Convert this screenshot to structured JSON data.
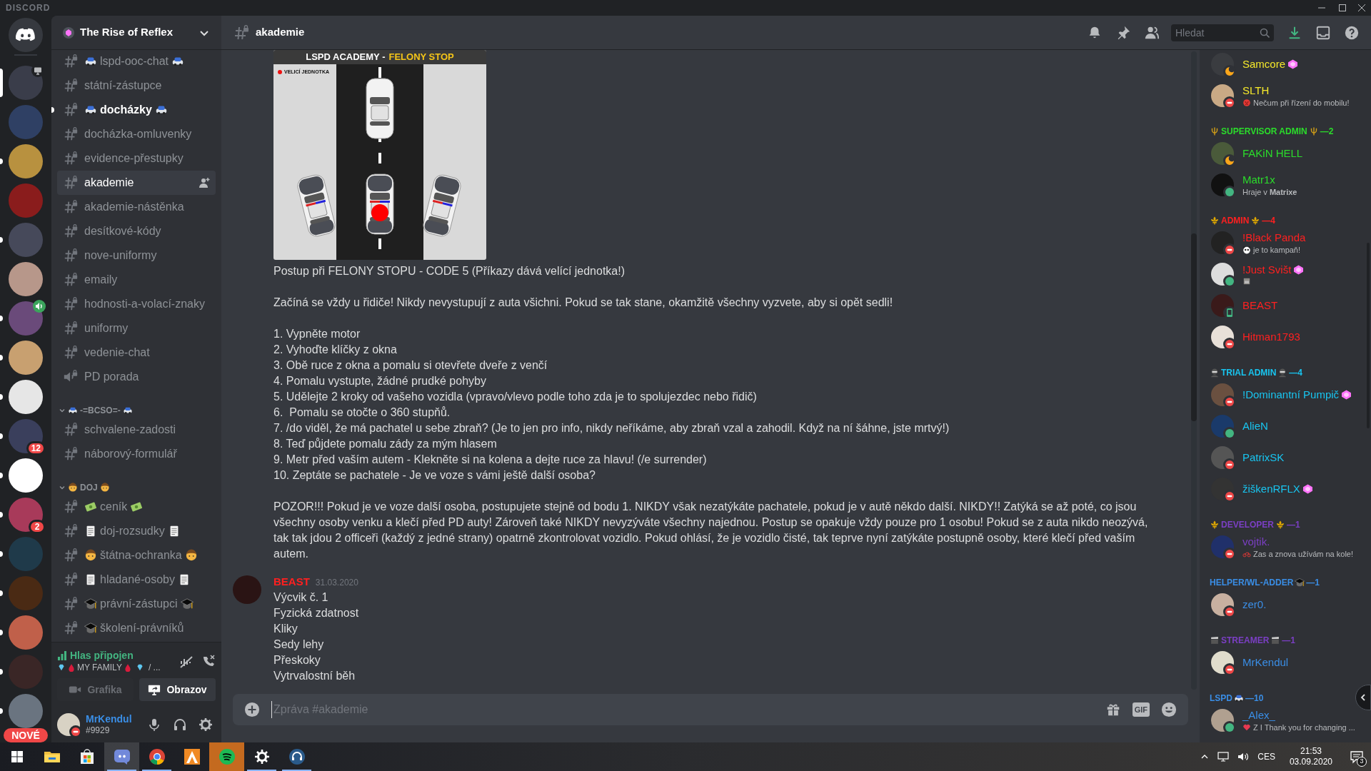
{
  "window": {
    "brand": "DISCORD"
  },
  "servers": [
    {
      "selected": true,
      "unread": false,
      "badge": {
        "kind": "screen"
      }
    },
    {
      "selected": false,
      "unread": false
    },
    {
      "selected": false,
      "unread": true
    },
    {
      "selected": false,
      "unread": false
    },
    {
      "selected": false,
      "unread": true
    },
    {
      "selected": false,
      "unread": false
    },
    {
      "selected": false,
      "unread": true,
      "badge": {
        "kind": "voice"
      }
    },
    {
      "selected": false,
      "unread": true
    },
    {
      "selected": false,
      "unread": true
    },
    {
      "selected": false,
      "unread": true,
      "mention": "12"
    },
    {
      "selected": false,
      "unread": true
    },
    {
      "selected": false,
      "unread": true,
      "mention": "2"
    },
    {
      "selected": false,
      "unread": true
    },
    {
      "selected": false,
      "unread": true
    },
    {
      "selected": false,
      "unread": true
    },
    {
      "selected": false,
      "unread": true
    },
    {
      "selected": false,
      "unread": true,
      "label": "NOVÉ"
    }
  ],
  "server": {
    "name": "The Rise of Reflex"
  },
  "channel_groups": [
    {
      "channels": [
        {
          "name": "lspd-ooc-chat",
          "kind": "text",
          "emoji": {
            "kind": "car",
            "before": true,
            "after": true
          },
          "unread": false,
          "selected": false
        },
        {
          "name": "státní-zástupce",
          "kind": "text",
          "unread": false,
          "selected": false
        },
        {
          "name": "docházky",
          "kind": "text",
          "emoji": {
            "kind": "car",
            "before": true,
            "after": true
          },
          "unread": true,
          "selected": false
        },
        {
          "name": "docházka-omluvenky",
          "kind": "text",
          "unread": false,
          "selected": false
        },
        {
          "name": "evidence-přestupky",
          "kind": "text",
          "unread": false,
          "selected": false
        },
        {
          "name": "akademie",
          "kind": "text",
          "unread": false,
          "selected": true
        },
        {
          "name": "akademie-nástěnka",
          "kind": "text",
          "unread": false,
          "selected": false
        },
        {
          "name": "desítkové-kódy",
          "kind": "text",
          "unread": false,
          "selected": false
        },
        {
          "name": "nove-uniformy",
          "kind": "text",
          "unread": false,
          "selected": false
        },
        {
          "name": "emaily",
          "kind": "text",
          "unread": false,
          "selected": false
        },
        {
          "name": "hodnosti-a-volací-znaky",
          "kind": "text",
          "unread": false,
          "selected": false
        },
        {
          "name": "uniformy",
          "kind": "text",
          "unread": false,
          "selected": false
        },
        {
          "name": "vedenie-chat",
          "kind": "text",
          "unread": false,
          "selected": false
        },
        {
          "name": "PD porada",
          "kind": "voice",
          "unread": false,
          "selected": false
        }
      ]
    },
    {
      "name": "-=BCSO=-",
      "emoji": {
        "kind": "car"
      },
      "expanded": true,
      "channels": [
        {
          "name": "schvalene-zadosti",
          "kind": "text",
          "unread": false,
          "selected": false
        },
        {
          "name": "náborový-formulář",
          "kind": "text",
          "unread": false,
          "selected": false
        }
      ]
    },
    {
      "name": "DOJ",
      "emoji": {
        "kind": "face"
      },
      "expanded": true,
      "channels": [
        {
          "name": "ceník",
          "kind": "text",
          "emoji": {
            "kind": "money",
            "before": true,
            "after": true
          },
          "unread": false,
          "selected": false
        },
        {
          "name": "doj-rozsudky",
          "kind": "text",
          "emoji": {
            "kind": "document",
            "before": true,
            "after": true
          },
          "unread": false,
          "selected": false
        },
        {
          "name": "štátna-ochranka",
          "kind": "text",
          "emoji": {
            "kind": "face",
            "before": true,
            "after": true
          },
          "unread": false,
          "selected": false
        },
        {
          "name": "hladané-osoby",
          "kind": "text",
          "emoji": {
            "kind": "document",
            "before": true,
            "after": true
          },
          "unread": false,
          "selected": false
        },
        {
          "name": "právní-zástupci",
          "kind": "text",
          "emoji": {
            "kind": "cap",
            "before": true,
            "after": true
          },
          "unread": false,
          "selected": false
        },
        {
          "name": "školení-právníků",
          "kind": "text",
          "emoji": {
            "kind": "cap",
            "before": true,
            "after": false
          },
          "unread": false,
          "selected": false
        }
      ]
    }
  ],
  "voice": {
    "status": "Hlas připojen",
    "channel": "MY FAMILY",
    "suffix": "/ ...",
    "buttons": [
      {
        "label": "Grafika",
        "kind": "video",
        "disabled": true
      },
      {
        "label": "Obrazov",
        "kind": "screen",
        "disabled": false
      }
    ]
  },
  "user": {
    "name": "MrKendul",
    "tag": "#9929",
    "status": {
      "kind": "dnd"
    },
    "color": "#3a8ee6"
  },
  "channel_header": {
    "name": "akademie"
  },
  "search": {
    "placeholder": "Hledat"
  },
  "messages": [
    {
      "attachment": {
        "title": "LSPD ACADEMY -",
        "highlight": "FELONY STOP",
        "legend": "VELICÍ JEDNOTKA"
      },
      "paragraphs": [
        [
          "Postup při FELONY STOPU - CODE 5 (Příkazy dává velící jednotka!)"
        ],
        [
          "Začíná se vždy u řidiče! Nikdy nevystupují z auta všichni. Pokud se tak stane, okamžitě všechny vyzvete, aby si opět sedli!"
        ],
        [
          "1. Vypněte motor",
          "2. Vyhoďte klíčky z okna",
          "3. Obě ruce z okna a pomalu si otevřete dveře z venčí",
          "4. Pomalu vystupte, žádné prudké pohyby",
          "5. Udělejte 2 kroky od vašeho vozidla (vpravo/vlevo podle toho zda je to spolujezdec nebo řidič)",
          "6.  Pomalu se otočte o 360 stupňů.",
          "7. /do viděl, že má pachatel u sebe zbraň? (Je to jen pro info, nikdy neříkáme, aby zbraň vzal a zahodil. Když na ní šáhne, jste mrtvý!)",
          "8. Teď půjdete pomalu zády za mým hlasem",
          "9. Metr před vaším autem - Klekněte si na kolena a dejte ruce za hlavu! (/e surrender)",
          "10. Zeptáte se pachatele - Je ve voze s vámi ještě další osoba?"
        ],
        [
          "POZOR!!! Pokud je ve voze další osoba, postupujete stejně od bodu 1. NIKDY však nezatýkáte pachatele, pokud je v autě někdo další. NIKDY!! Zatýká se až poté, co jsou všechny osoby venku a klečí před PD auty! Zároveň také NIKDY nevyzýváte všechny najednou. Postup se opakuje vždy pouze pro 1 osobu! Pokud se z auta nikdo neozývá, tak tak jdou 2 officeři (každý z jedné strany) opatrně zkontrolovat vozidlo. Pokud ohlásí, že je vozidlo čisté, tak teprve nyní zatýkáte postupně osoby, které klečí před vaším autem."
        ]
      ]
    },
    {
      "author": "BEAST",
      "color": "#ff2020",
      "timestamp": "31.03.2020",
      "paragraphs": [
        [
          "Výcvik č. 1",
          "Fyzická zdatnost",
          "Kliky",
          "Sedy lehy",
          "Přeskoky",
          "Vytrvalostní běh"
        ]
      ]
    }
  ],
  "composer": {
    "placeholder": "Zpráva #akademie",
    "gif": "GIF"
  },
  "member_groups": [
    {
      "members": [
        {
          "name": "Samcore",
          "color": "#f5e82a",
          "status": {
            "kind": "idle"
          },
          "boost": true
        },
        {
          "name": "SLTH",
          "color": "#f5e82a",
          "status": {
            "kind": "dnd"
          },
          "activity": "Nečum při řízení do mobilu!",
          "activity_emoji": {
            "kind": "angry"
          }
        }
      ]
    },
    {
      "role": "SUPERVISOR ADMIN",
      "count": "—2",
      "color": "#2bdc2b",
      "emoji": {
        "kind": "trident",
        "before": true
      },
      "members": [
        {
          "name": "FAKiN HELL",
          "color": "#2bdc2b",
          "status": {
            "kind": "idle"
          }
        },
        {
          "name": "Matr1x",
          "color": "#2bdc2b",
          "status": {
            "kind": "online"
          },
          "activity": "Hraje v **Matrixe**"
        }
      ]
    },
    {
      "role": "ADMIN",
      "count": "—4",
      "color": "#ff2020",
      "emoji": {
        "kind": "fleur",
        "before": true
      },
      "members": [
        {
          "name": "!Black Panda",
          "color": "#ff2020",
          "status": {
            "kind": "dnd"
          },
          "activity": "je to kampaň!",
          "activity_emoji": {
            "kind": "panda"
          }
        },
        {
          "name": "!Just Svišt",
          "color": "#ff2020",
          "status": {
            "kind": "online"
          },
          "boost": true,
          "activity_emoji": {
            "kind": "sticker"
          }
        },
        {
          "name": "BEAST",
          "color": "#ff2020",
          "status": {
            "kind": "mobile"
          }
        },
        {
          "name": "Hitman1793",
          "color": "#ff2020",
          "status": {
            "kind": "dnd"
          }
        }
      ]
    },
    {
      "role": "TRIAL ADMIN",
      "count": "—4",
      "color": "#18c5f0",
      "emoji": {
        "kind": "ninja",
        "before": true
      },
      "members": [
        {
          "name": "!Dominantní Pumpič",
          "color": "#18c5f0",
          "status": {
            "kind": "dnd"
          },
          "boost": true
        },
        {
          "name": "AlieN",
          "color": "#18c5f0",
          "status": {
            "kind": "online"
          }
        },
        {
          "name": "PatrixSK",
          "color": "#18c5f0",
          "status": {
            "kind": "dnd"
          }
        },
        {
          "name": "žiškenRFLX",
          "color": "#18c5f0",
          "status": {
            "kind": "dnd"
          },
          "boost": true
        }
      ]
    },
    {
      "role": "DEVELOPER",
      "count": "—1",
      "color": "#7b3fc4",
      "emoji": {
        "kind": "fleur",
        "before": true
      },
      "members": [
        {
          "name": "vojtik.",
          "color": "#7b3fc4",
          "status": {
            "kind": "dnd"
          },
          "activity": "Zas a znova užívám na kole!",
          "activity_emoji": {
            "kind": "bike"
          }
        }
      ]
    },
    {
      "role": "HELPER/WL-ADDER",
      "count": "—1",
      "color": "#3a8ee6",
      "emoji": {
        "kind": "cap",
        "before": false
      },
      "members": [
        {
          "name": "zer0.",
          "color": "#3a8ee6",
          "status": {
            "kind": "dnd"
          }
        }
      ]
    },
    {
      "role": "STREAMER",
      "count": "—1",
      "color": "#7b3fc4",
      "emoji": {
        "kind": "clapper",
        "before": true
      },
      "members": [
        {
          "name": "MrKendul",
          "color": "#3a8ee6",
          "status": {
            "kind": "dnd"
          }
        }
      ]
    },
    {
      "role": "LSPD",
      "count": "—10",
      "color": "#3a8ee6",
      "emoji": {
        "kind": "car",
        "before": false
      },
      "members": [
        {
          "name": "_Alex_",
          "color": "#3a8ee6",
          "status": {
            "kind": "online"
          },
          "activity": "Z I Thank you for changing ...",
          "activity_emoji": {
            "kind": "heart"
          }
        }
      ]
    }
  ],
  "taskbar": {
    "apps": [
      {
        "kind": "explorer",
        "running": false,
        "selected": false,
        "attention": false
      },
      {
        "kind": "store",
        "running": false,
        "selected": false,
        "attention": false
      },
      {
        "kind": "discord",
        "running": true,
        "selected": true,
        "attention": false
      },
      {
        "kind": "chrome",
        "running": true,
        "selected": false,
        "attention": false
      },
      {
        "kind": "orange",
        "running": false,
        "selected": false,
        "attention": false
      },
      {
        "kind": "spotify",
        "running": false,
        "selected": false,
        "attention": true
      },
      {
        "kind": "settings",
        "running": true,
        "selected": false,
        "attention": false
      },
      {
        "kind": "headset",
        "running": true,
        "selected": false,
        "attention": false
      }
    ],
    "tray": {
      "language": "CES",
      "time": "21:53",
      "date": "03.09.2020",
      "notifications": "3"
    }
  }
}
